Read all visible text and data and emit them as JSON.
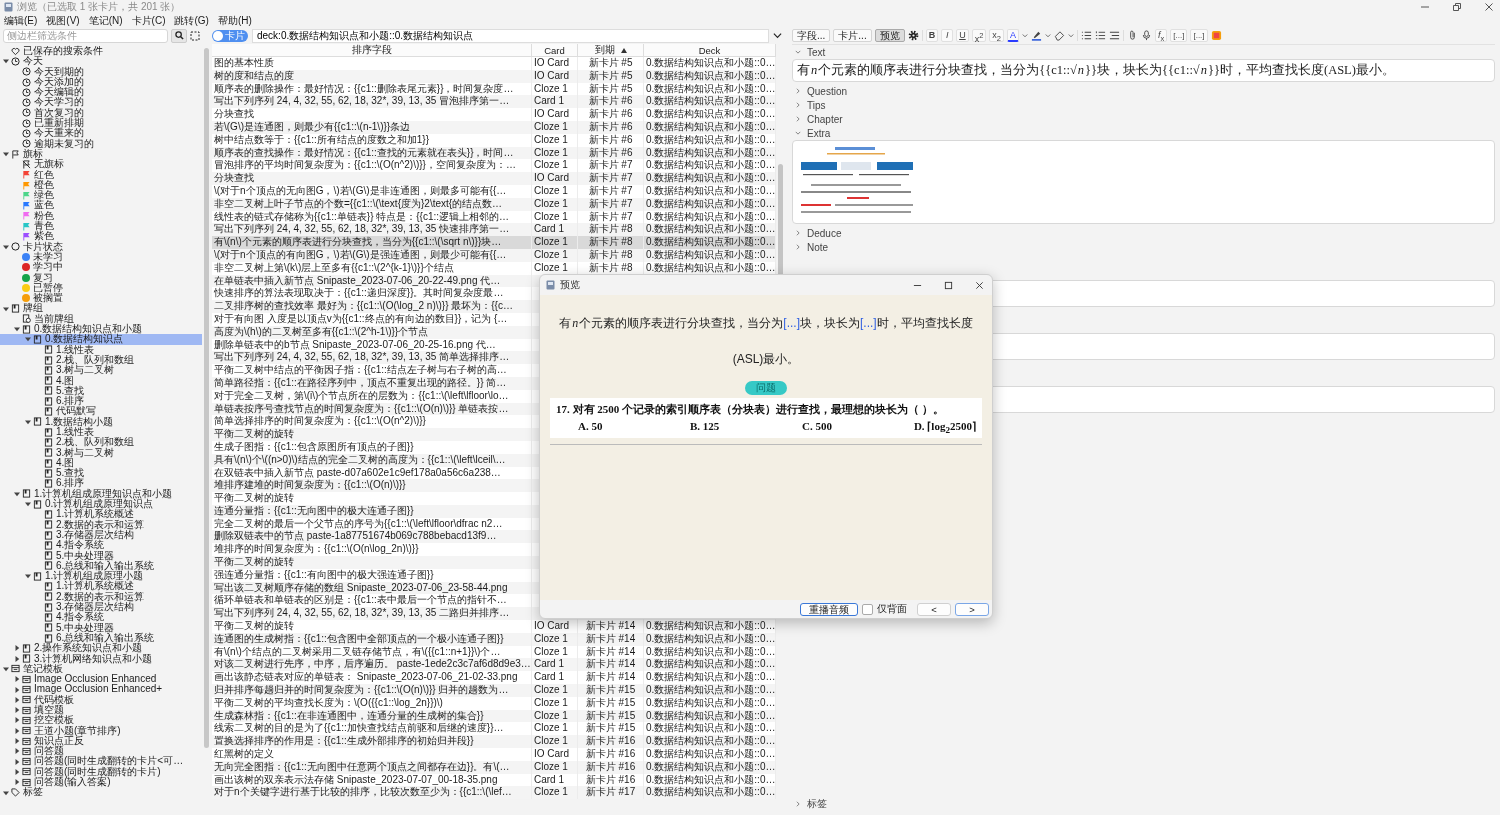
{
  "window": {
    "title": "浏览（已选取 1 张卡片，共 201 张）"
  },
  "menu": [
    "编辑(E)",
    "视图(V)",
    "笔记(N)",
    "卡片(C)",
    "跳转(G)",
    "帮助(H)"
  ],
  "sidebar": {
    "filter_placeholder": "侧边栏筛选条件",
    "tree": [
      {
        "label": "已保存的搜索条件",
        "kind": "saved",
        "selected": false
      },
      {
        "label": "今天",
        "kind": "today",
        "expanded": true,
        "selected": false,
        "children": [
          {
            "label": "今天到期的",
            "kind": "today",
            "selected": false
          },
          {
            "label": "今天添加的",
            "kind": "today",
            "selected": false
          },
          {
            "label": "今天编辑的",
            "kind": "today",
            "selected": false
          },
          {
            "label": "今天学习的",
            "kind": "today",
            "selected": false
          },
          {
            "label": "首次复习的",
            "kind": "today",
            "selected": false
          },
          {
            "label": "已重新排期",
            "kind": "today",
            "selected": false
          },
          {
            "label": "今天重来的",
            "kind": "today",
            "selected": false
          },
          {
            "label": "逾期未复习的",
            "kind": "today",
            "selected": false
          }
        ]
      },
      {
        "label": "旗标",
        "kind": "flags",
        "expanded": true,
        "selected": false,
        "children": [
          {
            "label": "无旗标",
            "kind": "noflag",
            "selected": false
          },
          {
            "label": "红色",
            "kind": "flag",
            "color": "#f44336",
            "selected": false
          },
          {
            "label": "橙色",
            "kind": "flag",
            "color": "#ff9800",
            "selected": false
          },
          {
            "label": "绿色",
            "kind": "flag",
            "color": "#4cd68a",
            "selected": false
          },
          {
            "label": "蓝色",
            "kind": "flag",
            "color": "#2979ff",
            "selected": false
          },
          {
            "label": "粉色",
            "kind": "flag",
            "color": "#f06af0",
            "selected": false
          },
          {
            "label": "青色",
            "kind": "flag",
            "color": "#26c6c6",
            "selected": false
          },
          {
            "label": "紫色",
            "kind": "flag",
            "color": "#9c4dff",
            "selected": false
          }
        ]
      },
      {
        "label": "卡片状态",
        "kind": "states",
        "expanded": true,
        "selected": false,
        "children": [
          {
            "label": "未学习",
            "kind": "state",
            "color": "#3b82f6",
            "selected": false
          },
          {
            "label": "学习中",
            "kind": "state",
            "color": "#dc2626",
            "selected": false
          },
          {
            "label": "复习",
            "kind": "state",
            "color": "#16a34a",
            "selected": false
          },
          {
            "label": "已暂停",
            "kind": "state",
            "color": "#facc15",
            "selected": false
          },
          {
            "label": "被搁置",
            "kind": "state",
            "color": "#f59e0b",
            "selected": false
          }
        ]
      },
      {
        "label": "牌组",
        "kind": "deck",
        "expanded": true,
        "selected": false,
        "children": [
          {
            "label": "当前牌组",
            "kind": "current",
            "selected": false
          },
          {
            "label": "0.数据结构知识点和小题",
            "kind": "deck",
            "expanded": true,
            "selected": false,
            "children": [
              {
                "label": "0.数据结构知识点",
                "kind": "deck",
                "expanded": true,
                "selected": true,
                "children": [
                  {
                    "label": "1.线性表",
                    "kind": "deck",
                    "selected": false
                  },
                  {
                    "label": "2.栈、队列和数组",
                    "kind": "deck",
                    "selected": false
                  },
                  {
                    "label": "3.树与二叉树",
                    "kind": "deck",
                    "selected": false
                  },
                  {
                    "label": "4.图",
                    "kind": "deck",
                    "selected": false
                  },
                  {
                    "label": "5.查找",
                    "kind": "deck",
                    "selected": false
                  },
                  {
                    "label": "6.排序",
                    "kind": "deck",
                    "selected": false
                  },
                  {
                    "label": "代码默写",
                    "kind": "deck",
                    "selected": false
                  }
                ]
              },
              {
                "label": "1.数据结构小题",
                "kind": "deck",
                "expanded": true,
                "selected": false,
                "children": [
                  {
                    "label": "1.线性表",
                    "kind": "deck",
                    "selected": false
                  },
                  {
                    "label": "2.栈、队列和数组",
                    "kind": "deck",
                    "selected": false
                  },
                  {
                    "label": "3.树与二叉树",
                    "kind": "deck",
                    "selected": false
                  },
                  {
                    "label": "4.图",
                    "kind": "deck",
                    "selected": false
                  },
                  {
                    "label": "5.查找",
                    "kind": "deck",
                    "selected": false
                  },
                  {
                    "label": "6.排序",
                    "kind": "deck",
                    "selected": false
                  }
                ]
              }
            ]
          },
          {
            "label": "1.计算机组成原理知识点和小题",
            "kind": "deck",
            "expanded": true,
            "selected": false,
            "children": [
              {
                "label": "0.计算机组成原理知识点",
                "kind": "deck",
                "expanded": true,
                "selected": false,
                "children": [
                  {
                    "label": "1.计算机系统概述",
                    "kind": "deck",
                    "selected": false
                  },
                  {
                    "label": "2.数据的表示和运算",
                    "kind": "deck",
                    "selected": false
                  },
                  {
                    "label": "3.存储器层次结构",
                    "kind": "deck",
                    "selected": false
                  },
                  {
                    "label": "4.指令系统",
                    "kind": "deck",
                    "selected": false
                  },
                  {
                    "label": "5.中央处理器",
                    "kind": "deck",
                    "selected": false
                  },
                  {
                    "label": "6.总线和输入输出系统",
                    "kind": "deck",
                    "selected": false
                  }
                ]
              },
              {
                "label": "1.计算机组成原理小题",
                "kind": "deck",
                "expanded": true,
                "selected": false,
                "children": [
                  {
                    "label": "1.计算机系统概述",
                    "kind": "deck",
                    "selected": false
                  },
                  {
                    "label": "2.数据的表示和运算",
                    "kind": "deck",
                    "selected": false
                  },
                  {
                    "label": "3.存储器层次结构",
                    "kind": "deck",
                    "selected": false
                  },
                  {
                    "label": "4.指令系统",
                    "kind": "deck",
                    "selected": false
                  },
                  {
                    "label": "5.中央处理器",
                    "kind": "deck",
                    "selected": false
                  },
                  {
                    "label": "6.总线和输入输出系统",
                    "kind": "deck",
                    "selected": false
                  }
                ]
              }
            ]
          },
          {
            "label": "2.操作系统知识点和小题",
            "kind": "deck",
            "expanded": false,
            "selected": false
          },
          {
            "label": "3.计算机网络知识点和小题",
            "kind": "deck",
            "expanded": false,
            "selected": false
          }
        ]
      },
      {
        "label": "笔记模板",
        "kind": "notetype",
        "expanded": true,
        "selected": false,
        "children": [
          {
            "label": "Image Occlusion Enhanced",
            "kind": "notetype",
            "expanded": false,
            "selected": false
          },
          {
            "label": "Image Occlusion Enhanced+",
            "kind": "notetype",
            "expanded": false,
            "selected": false
          },
          {
            "label": "代码模板",
            "kind": "notetype",
            "expanded": false,
            "selected": false
          },
          {
            "label": "填空题",
            "kind": "notetype",
            "expanded": false,
            "selected": false
          },
          {
            "label": "挖空模板",
            "kind": "notetype",
            "expanded": false,
            "selected": false
          },
          {
            "label": "王道小题(章节排序)",
            "kind": "notetype",
            "expanded": false,
            "selected": false
          },
          {
            "label": "知识点正反",
            "kind": "notetype",
            "expanded": false,
            "selected": false
          },
          {
            "label": "问答题",
            "kind": "notetype",
            "expanded": false,
            "selected": false
          },
          {
            "label": "问答题(同时生成翻转的卡片<可…",
            "kind": "notetype",
            "expanded": false,
            "selected": false
          },
          {
            "label": "问答题(同时生成翻转的卡片)",
            "kind": "notetype",
            "expanded": false,
            "selected": false
          },
          {
            "label": "问答题(输入答案)",
            "kind": "notetype",
            "expanded": false,
            "selected": false
          }
        ]
      },
      {
        "label": "标签",
        "kind": "tags",
        "expanded": true,
        "selected": false
      }
    ]
  },
  "search": {
    "mode_label": "卡片",
    "query": "deck:0.数据结构知识点和小题::0.数据结构知识点"
  },
  "table": {
    "columns": [
      {
        "label": "排序字段",
        "sorted": false
      },
      {
        "label": "Card",
        "sorted": false
      },
      {
        "label": "到期",
        "sorted": true
      },
      {
        "label": "Deck",
        "sorted": false
      }
    ],
    "rows": [
      {
        "sort_field": "图的基本性质",
        "card": "IO Card",
        "due": "新卡片 #5",
        "deck": "0.数据结构知识点和小题::0…",
        "selected": false
      },
      {
        "sort_field": "树的度和结点的度",
        "card": "IO Card",
        "due": "新卡片 #5",
        "deck": "0.数据结构知识点和小题::0…",
        "selected": false
      },
      {
        "sort_field": "顺序表的删除操作：最好情况：{{c1::删除表尾元素}}，时间复杂度…",
        "card": "Cloze 1",
        "due": "新卡片 #5",
        "deck": "0.数据结构知识点和小题::0…",
        "selected": false
      },
      {
        "sort_field": "写出下列序列 24, 4, 32, 55, 62, 18, 32*, 39, 13, 35 冒泡排序第一…",
        "card": "Card 1",
        "due": "新卡片 #6",
        "deck": "0.数据结构知识点和小题::0…",
        "selected": false
      },
      {
        "sort_field": "分块查找",
        "card": "IO Card",
        "due": "新卡片 #6",
        "deck": "0.数据结构知识点和小题::0…",
        "selected": false
      },
      {
        "sort_field": "若\\(G\\)是连通图，则最少有{{c1::\\(n-1\\)}}条边",
        "card": "Cloze 1",
        "due": "新卡片 #6",
        "deck": "0.数据结构知识点和小题::0…",
        "selected": false
      },
      {
        "sort_field": "树中结点数等于：{{c1::所有结点的度数之和加1}}",
        "card": "Cloze 1",
        "due": "新卡片 #6",
        "deck": "0.数据结构知识点和小题::0…",
        "selected": false
      },
      {
        "sort_field": "顺序表的查找操作：最好情况：{{c1::查找的元素就在表头}}，时间…",
        "card": "Cloze 1",
        "due": "新卡片 #6",
        "deck": "0.数据结构知识点和小题::0…",
        "selected": false
      },
      {
        "sort_field": "冒泡排序的平均时间复杂度为：{{c1::\\(O(n^2)\\)}}，空间复杂度为：…",
        "card": "Cloze 1",
        "due": "新卡片 #7",
        "deck": "0.数据结构知识点和小题::0…",
        "selected": false
      },
      {
        "sort_field": "分块查找",
        "card": "IO Card",
        "due": "新卡片 #7",
        "deck": "0.数据结构知识点和小题::0…",
        "selected": false
      },
      {
        "sort_field": "\\(对于n个顶点的无向图G，\\)若\\(G\\)是非连通图，则最多可能有{{…",
        "card": "Cloze 1",
        "due": "新卡片 #7",
        "deck": "0.数据结构知识点和小题::0…",
        "selected": false
      },
      {
        "sort_field": "非空二叉树上叶子节点的个数={{c1::\\(\\text{度为}2\\text{的结点数…",
        "card": "Cloze 1",
        "due": "新卡片 #7",
        "deck": "0.数据结构知识点和小题::0…",
        "selected": false
      },
      {
        "sort_field": "线性表的链式存储称为{{c1::单链表}} 特点是：{{c1::逻辑上相邻的…",
        "card": "Cloze 1",
        "due": "新卡片 #7",
        "deck": "0.数据结构知识点和小题::0…",
        "selected": false
      },
      {
        "sort_field": "写出下列序列 24, 4, 32, 55, 62, 18, 32*, 39, 13, 35 快速排序第一…",
        "card": "Card 1",
        "due": "新卡片 #8",
        "deck": "0.数据结构知识点和小题::0…",
        "selected": false
      },
      {
        "sort_field": "有\\(n\\)个元素的顺序表进行分块查找，当分为{{c1::\\(\\sqrt n\\)}}块…",
        "card": "Cloze 1",
        "due": "新卡片 #8",
        "deck": "0.数据结构知识点和小题::0…",
        "selected": true
      },
      {
        "sort_field": "\\(对于n个顶点的有向图G，\\)若\\(G\\)是强连通图，则最少可能有{{…",
        "card": "Cloze 1",
        "due": "新卡片 #8",
        "deck": "0.数据结构知识点和小题::0…",
        "selected": false
      },
      {
        "sort_field": "非空二叉树上第\\(k\\)层上至多有{{c1::\\(2^{k-1}\\)}}个结点",
        "card": "Cloze 1",
        "due": "新卡片 #8",
        "deck": "0.数据结构知识点和小题::0…",
        "selected": false
      },
      {
        "sort_field": "在单链表中插入新节点 Snipaste_2023-07-06_20-22-49.png 代…",
        "selected": false
      },
      {
        "sort_field": "快速排序的算法表现取决于：{{c1::递归深度}}。其时间复杂度最…",
        "selected": false
      },
      {
        "sort_field": "二叉排序树的查找效率 最好为：{{c1::\\(O(\\log_2 n)\\)}} 最坏为：{{c…",
        "selected": false
      },
      {
        "sort_field": "对于有向图 入度是以顶点v为{{c1::终点的有向边的数目}}，记为 {…",
        "selected": false
      },
      {
        "sort_field": "高度为\\(h\\)的二叉树至多有{{c1::\\(2^h-1\\)}}个节点",
        "selected": false
      },
      {
        "sort_field": "删除单链表中的b节点 Snipaste_2023-07-06_20-25-16.png 代…",
        "selected": false
      },
      {
        "sort_field": "写出下列序列 24, 4, 32, 55, 62, 18, 32*, 39, 13, 35 简单选择排序…",
        "selected": false
      },
      {
        "sort_field": "平衡二叉树中结点的平衡因子指：{{c1::结点左子树与右子树的高…",
        "selected": false
      },
      {
        "sort_field": "简单路径指：{{c1::在路径序列中，顶点不重复出现的路径。}} 简…",
        "selected": false
      },
      {
        "sort_field": "对于完全二叉树，第\\(i\\)个节点所在的层数为：{{c1::\\(\\left\\lfloor\\lo…",
        "selected": false
      },
      {
        "sort_field": "单链表按序号查找节点的时间复杂度为：{{c1::\\(O(n)\\)}} 单链表按…",
        "selected": false
      },
      {
        "sort_field": "简单选择排序的时间复杂度为：{{c1::\\(O(n^2)\\)}}",
        "selected": false
      },
      {
        "sort_field": "平衡二叉树的旋转",
        "selected": false
      },
      {
        "sort_field": "生成子图指：{{c1::包含原图所有顶点的子图}}",
        "selected": false
      },
      {
        "sort_field": "具有\\(n\\)个\\((n>0)\\)结点的完全二叉树的高度为：{{c1::\\(\\left\\lceil\\…",
        "selected": false
      },
      {
        "sort_field": "在双链表中插入新节点 paste-d07a602e1c9ef178a0a56c6a238…",
        "selected": false
      },
      {
        "sort_field": "堆排序建堆的时间复杂度为：{{c1::\\(O(n)\\)}}",
        "selected": false
      },
      {
        "sort_field": "平衡二叉树的旋转",
        "selected": false
      },
      {
        "sort_field": "连通分量指：{{c1::无向图中的极大连通子图}}",
        "selected": false
      },
      {
        "sort_field": "完全二叉树的最后一个父节点的序号为{{c1::\\(\\left\\lfloor\\dfrac n2…",
        "selected": false
      },
      {
        "sort_field": "删除双链表中的节点 paste-1a87751674b069c788bebacd13f9…",
        "selected": false
      },
      {
        "sort_field": "堆排序的时间复杂度为：{{c1::\\(O(n\\log_2n)\\)}}",
        "selected": false
      },
      {
        "sort_field": "平衡二叉树的旋转",
        "selected": false
      },
      {
        "sort_field": "强连通分量指：{{c1::有向图中的极大强连通子图}}",
        "selected": false
      },
      {
        "sort_field": "写出该二叉树顺序存储的数组 Snipaste_2023-07-06_23-58-44.png",
        "selected": false
      },
      {
        "sort_field": "循环单链表和单链表的区别是：{{c1::表中最后一个节点的指针不…",
        "selected": false
      },
      {
        "sort_field": "写出下列序列 24, 4, 32, 55, 62, 18, 32*, 39, 13, 35 二路归并排序…",
        "selected": false
      },
      {
        "sort_field": "平衡二叉树的旋转",
        "card": "IO Card",
        "due": "新卡片 #14",
        "deck": "0.数据结构知识点和小题::0…",
        "selected": false
      },
      {
        "sort_field": "连通图的生成树指：{{c1::包含图中全部顶点的一个极小连通子图}}",
        "card": "Cloze 1",
        "due": "新卡片 #14",
        "deck": "0.数据结构知识点和小题::0…",
        "selected": false
      },
      {
        "sort_field": "有\\(n\\)个结点的二叉树采用二叉链存储节点，有\\({{c1::n+1}}\\)个…",
        "card": "Cloze 1",
        "due": "新卡片 #14",
        "deck": "0.数据结构知识点和小题::0…",
        "selected": false
      },
      {
        "sort_field": "对该二叉树进行先序，中序，后序遍历。 paste-1ede2c3c7af6d8d9e3…",
        "card": "Card 1",
        "due": "新卡片 #14",
        "deck": "0.数据结构知识点和小题::0…",
        "selected": false
      },
      {
        "sort_field": "画出该静态链表对应的单链表： Snipaste_2023-07-06_21-02-33.png",
        "card": "Card 1",
        "due": "新卡片 #14",
        "deck": "0.数据结构知识点和小题::0…",
        "selected": false
      },
      {
        "sort_field": "归并排序每趟归并的时间复杂度为：{{c1::\\(O(n)\\)}} 归并的趟数为…",
        "card": "Cloze 1",
        "due": "新卡片 #15",
        "deck": "0.数据结构知识点和小题::0…",
        "selected": false
      },
      {
        "sort_field": "平衡二叉树的平均查找长度为：\\(O({{c1::\\log_2n}})\\)",
        "card": "Cloze 1",
        "due": "新卡片 #15",
        "deck": "0.数据结构知识点和小题::0…",
        "selected": false
      },
      {
        "sort_field": "生成森林指：{{c1::在非连通图中，连通分量的生成树的集合}}",
        "card": "Cloze 1",
        "due": "新卡片 #15",
        "deck": "0.数据结构知识点和小题::0…",
        "selected": false
      },
      {
        "sort_field": "线索二叉树的目的是为了{{c1::加快查找结点前驱和后继的速度}}…",
        "card": "Cloze 1",
        "due": "新卡片 #15",
        "deck": "0.数据结构知识点和小题::0…",
        "selected": false
      },
      {
        "sort_field": "置换选择排序的作用是：{{c1::生成外部排序的初始归并段}}",
        "card": "Cloze 1",
        "due": "新卡片 #16",
        "deck": "0.数据结构知识点和小题::0…",
        "selected": false
      },
      {
        "sort_field": "红黑树的定义",
        "card": "IO Card",
        "due": "新卡片 #16",
        "deck": "0.数据结构知识点和小题::0…",
        "selected": false
      },
      {
        "sort_field": "无向完全图指：{{c1::无向图中任意两个顶点之间都存在边}}。有\\(…",
        "card": "Cloze 1",
        "due": "新卡片 #16",
        "deck": "0.数据结构知识点和小题::0…",
        "selected": false
      },
      {
        "sort_field": "画出该树的双亲表示法存储 Snipaste_2023-07-07_00-18-35.png",
        "card": "Card 1",
        "due": "新卡片 #16",
        "deck": "0.数据结构知识点和小题::0…",
        "selected": false
      },
      {
        "sort_field": "对于n个关键字进行基于比较的排序，比较次数至少为：{{c1::\\(\\lef…",
        "card": "Cloze 1",
        "due": "新卡片 #17",
        "deck": "0.数据结构知识点和小题::0…",
        "selected": false
      }
    ]
  },
  "editor": {
    "mode_buttons": [
      {
        "label": "字段...",
        "selected": false
      },
      {
        "label": "卡片...",
        "selected": false
      },
      {
        "label": "预览",
        "selected": true
      }
    ],
    "format_buttons": [
      "B",
      "I",
      "U",
      "x$^{2}$",
      "x$_{2}$",
      "A"
    ],
    "math_button": "*f*$_{x}$",
    "cloze_buttons": [
      "[...]",
      "[...]"
    ],
    "fields": [
      {
        "kind": "text",
        "label": "Text",
        "expanded": true,
        "value": [
          {
            "kind": "text",
            "text": "有"
          },
          {
            "kind": "math",
            "text": "n"
          },
          {
            "kind": "text",
            "text": "个元素的顺序表进行分块查找，当分为{{c1::√"
          },
          {
            "kind": "math",
            "text": "n"
          },
          {
            "kind": "text",
            "text": "}}块，块长为{{c1::√"
          },
          {
            "kind": "math",
            "text": "n"
          },
          {
            "kind": "text",
            "text": "}}时，平均查找长度(ASL)最小。"
          }
        ]
      },
      {
        "kind": "text",
        "label": "Question",
        "expanded": false
      },
      {
        "kind": "text",
        "label": "Tips",
        "expanded": false
      },
      {
        "kind": "text",
        "label": "Chapter",
        "expanded": false
      },
      {
        "kind": "picture",
        "label": "Extra",
        "expanded": true
      },
      {
        "kind": "text",
        "label": "Deduce",
        "expanded": false
      },
      {
        "kind": "text",
        "label": "Note",
        "expanded": false
      },
      {
        "kind": "covered"
      },
      {
        "kind": "covered"
      },
      {
        "kind": "covered"
      }
    ],
    "tags_label": "标签"
  },
  "preview": {
    "title": "预览",
    "front": [
      {
        "kind": "text",
        "text": "有"
      },
      {
        "kind": "math",
        "text": "n"
      },
      {
        "kind": "text",
        "text": "个元素的顺序表进行分块查找，当分为"
      },
      {
        "kind": "cloze",
        "text": "[...]"
      },
      {
        "kind": "text",
        "text": "块，块长为"
      },
      {
        "kind": "cloze",
        "text": "[...]"
      },
      {
        "kind": "text",
        "text": "时，平均查找长度(ASL)最小。"
      }
    ],
    "answer_button": "问题",
    "question_image": {
      "stem": "17.  对有 2500 个记录的索引顺序表（分块表）进行查找，最理想的块长为（  ）。",
      "options": [
        "A.  50",
        "B.  125",
        "C.  500",
        "D.  ⌈log$_{2}$2500⌉"
      ]
    },
    "replay_button": "重播音频",
    "back_only": {
      "label": "仅背面",
      "checked": false
    },
    "prev_button": "<",
    "next_button": ">"
  }
}
